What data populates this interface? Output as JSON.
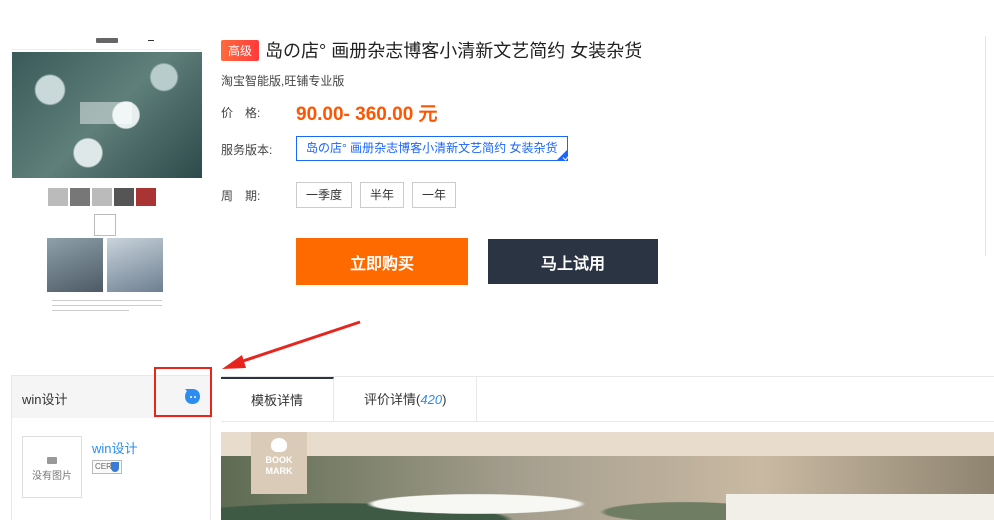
{
  "product": {
    "badge": "高级",
    "title": "岛の店° 画册杂志博客小清新文艺简约 女装杂货",
    "subtitle": "淘宝智能版,旺铺专业版",
    "price_label": "价　格:",
    "price": "90.00- 360.00 元",
    "service_label": "服务版本:",
    "service_option": "岛の店° 画册杂志博客小清新文艺简约 女装杂货",
    "period_label": "周　期:",
    "periods": [
      "一季度",
      "半年",
      "一年"
    ],
    "buy_label": "立即购买",
    "try_label": "马上试用"
  },
  "shop": {
    "name": "win设计",
    "link": "win设计",
    "no_image": "没有图片",
    "cert_text": "CERT"
  },
  "tabs": [
    {
      "label": "模板详情",
      "count": ""
    },
    {
      "label": "评价详情",
      "count": "420"
    }
  ],
  "bookmark": {
    "line1": "BOOK",
    "line2": "MARK"
  },
  "colors": {
    "accent_orange": "#ff6a00",
    "dark_button": "#2b3443",
    "highlight_red": "#e8251d",
    "link_blue": "#2d8cf0"
  }
}
